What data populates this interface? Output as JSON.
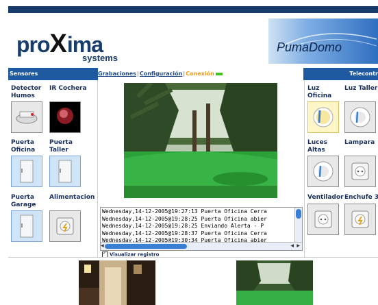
{
  "header": {
    "logo_pro": "pro",
    "logo_x": "X",
    "logo_ima": "ima",
    "logo_sub": "systems",
    "brand": "PumaDomo"
  },
  "nav": {
    "sensores": "Sensores",
    "grabaciones": "Grabaciones",
    "configuracion": "Configuración",
    "conexion": "Conexión",
    "telecontrol": "Telecontr"
  },
  "sensors": [
    {
      "label_1": "Detector",
      "label_2": "Humos",
      "icon": "smoke-detector-icon"
    },
    {
      "label_1": "IR Cochera",
      "label_2": "",
      "icon": "ir-sensor-icon"
    },
    {
      "label_1": "Puerta",
      "label_2": "Oficina",
      "icon": "door-icon"
    },
    {
      "label_1": "Puerta Taller",
      "label_2": "",
      "icon": "door-icon"
    },
    {
      "label_1": "Puerta",
      "label_2": "Garage",
      "icon": "door-icon"
    },
    {
      "label_1": "Alimentacion",
      "label_2": "",
      "icon": "power-outlet-icon"
    }
  ],
  "controls": [
    {
      "label_1": "Luz",
      "label_2": "Oficina",
      "icon": "light-bulb-icon"
    },
    {
      "label_1": "Luz Taller",
      "label_2": "",
      "icon": "light-bulb-icon"
    },
    {
      "label_1": "Luces",
      "label_2": "Altas",
      "icon": "light-bulb-icon"
    },
    {
      "label_1": "Lampara",
      "label_2": "",
      "icon": "outlet-icon"
    },
    {
      "label_1": "Ventilador",
      "label_2": "",
      "icon": "outlet-icon"
    },
    {
      "label_1": "Enchufe 3",
      "label_2": "",
      "icon": "outlet-icon"
    }
  ],
  "log": {
    "lines": [
      "Wednesday,14-12-2005@19:27:13 Puerta Oficina Cerra",
      "Wednesday,14-12-2005@19:28:25 Puerta Oficina abier",
      "Wednesday,14-12-2005@19:28:25 Enviando  Alerta - P",
      "Wednesday,14-12-2005@19:28:37 Puerta Oficina Cerra",
      "Wednesday,14-12-2005@19:30:34 Puerta Oficina abier"
    ],
    "checkbox_label": "Visualizar registro"
  },
  "colors": {
    "accent": "#1e5aa0",
    "connection": "#3ec41a",
    "label": "#1a3060"
  }
}
